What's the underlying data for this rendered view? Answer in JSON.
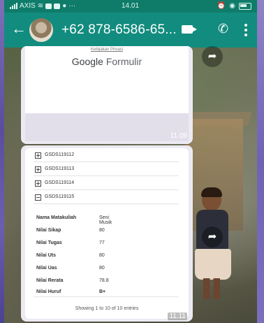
{
  "status": {
    "carrier": "AXIS",
    "time": "14.01"
  },
  "header": {
    "back_icon": "arrow-left-icon",
    "contact": "+62 878-6586-65...",
    "video_icon": "video-call-icon",
    "call_icon": "phone-icon",
    "menu_icon": "more-vert-icon"
  },
  "messages": [
    {
      "privacy_link": "Kebijakan Privasi",
      "brand_google": "Google",
      "brand_formulir": "Formulir",
      "time": "11.09"
    },
    {
      "codes": [
        "GSDS119112",
        "GSDS119113",
        "GSDS119114",
        "GSDS119115"
      ],
      "details": [
        {
          "key": "Nama Matakuliah",
          "value": "Seni Musik"
        },
        {
          "key": "Nilai Sikap",
          "value": "80"
        },
        {
          "key": "Nilai Tugas",
          "value": "77"
        },
        {
          "key": "Nilai Uts",
          "value": "80"
        },
        {
          "key": "Nilai Uas",
          "value": "80"
        },
        {
          "key": "Nilai Rerata",
          "value": "78.8"
        },
        {
          "key": "Nilai Huruf",
          "value": "B+"
        }
      ],
      "footer": "Showing 1 to 10 of 10 entries",
      "time": "11.11"
    }
  ],
  "colors": {
    "status_bar": "#0f7c6a",
    "app_bar": "#128c7e"
  }
}
